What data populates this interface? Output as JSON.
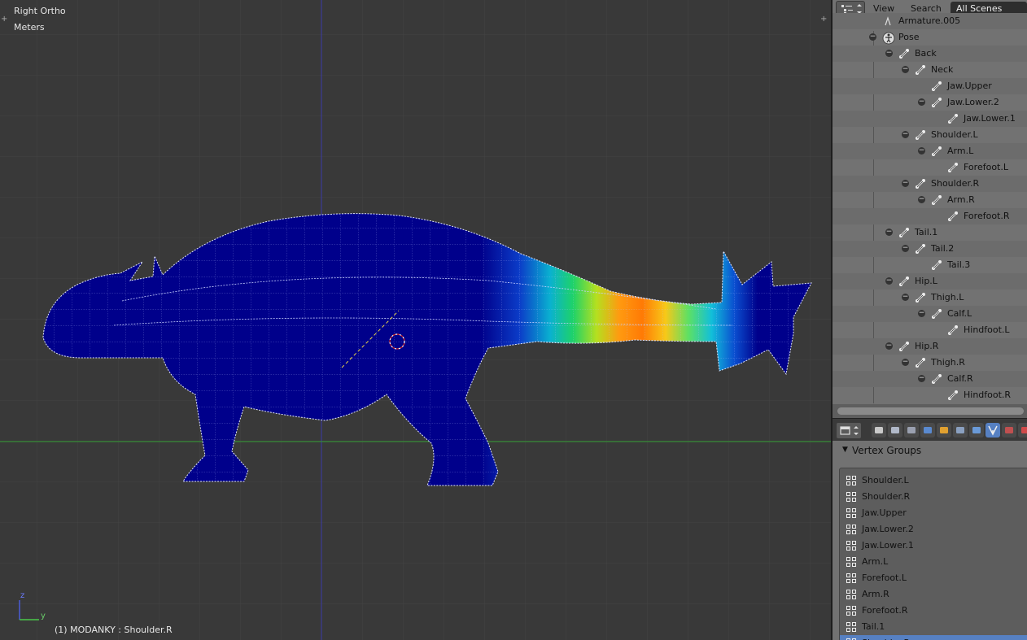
{
  "viewport": {
    "view_name": "Right Ortho",
    "units": "Meters",
    "status_text": "(1) MODANKY : Shoulder.R",
    "axis_z_label": "z",
    "axis_y_label": "y",
    "corner_plus": "+"
  },
  "outliner": {
    "menu": {
      "view": "View",
      "search": "Search",
      "scene": "All Scenes"
    },
    "rows": [
      {
        "label": "Armature.005",
        "indent": 0,
        "toggle": false,
        "icon": "armature-icon"
      },
      {
        "label": "Pose",
        "indent": 0,
        "toggle": true,
        "icon": "pose-icon"
      },
      {
        "label": "Back",
        "indent": 1,
        "toggle": true,
        "icon": "bone-icon"
      },
      {
        "label": "Neck",
        "indent": 2,
        "toggle": true,
        "icon": "bone-icon"
      },
      {
        "label": "Jaw.Upper",
        "indent": 3,
        "toggle": false,
        "icon": "bone-icon"
      },
      {
        "label": "Jaw.Lower.2",
        "indent": 3,
        "toggle": true,
        "icon": "bone-icon"
      },
      {
        "label": "Jaw.Lower.1",
        "indent": 4,
        "toggle": false,
        "icon": "bone-icon"
      },
      {
        "label": "Shoulder.L",
        "indent": 2,
        "toggle": true,
        "icon": "bone-icon"
      },
      {
        "label": "Arm.L",
        "indent": 3,
        "toggle": true,
        "icon": "bone-icon"
      },
      {
        "label": "Forefoot.L",
        "indent": 4,
        "toggle": false,
        "icon": "bone-icon"
      },
      {
        "label": "Shoulder.R",
        "indent": 2,
        "toggle": true,
        "icon": "bone-icon"
      },
      {
        "label": "Arm.R",
        "indent": 3,
        "toggle": true,
        "icon": "bone-icon"
      },
      {
        "label": "Forefoot.R",
        "indent": 4,
        "toggle": false,
        "icon": "bone-icon"
      },
      {
        "label": "Tail.1",
        "indent": 1,
        "toggle": true,
        "icon": "bone-icon"
      },
      {
        "label": "Tail.2",
        "indent": 2,
        "toggle": true,
        "icon": "bone-icon"
      },
      {
        "label": "Tail.3",
        "indent": 3,
        "toggle": false,
        "icon": "bone-icon"
      },
      {
        "label": "Hip.L",
        "indent": 1,
        "toggle": true,
        "icon": "bone-icon"
      },
      {
        "label": "Thigh.L",
        "indent": 2,
        "toggle": true,
        "icon": "bone-icon"
      },
      {
        "label": "Calf.L",
        "indent": 3,
        "toggle": true,
        "icon": "bone-icon"
      },
      {
        "label": "Hindfoot.L",
        "indent": 4,
        "toggle": false,
        "icon": "bone-icon"
      },
      {
        "label": "Hip.R",
        "indent": 1,
        "toggle": true,
        "icon": "bone-icon"
      },
      {
        "label": "Thigh.R",
        "indent": 2,
        "toggle": true,
        "icon": "bone-icon"
      },
      {
        "label": "Calf.R",
        "indent": 3,
        "toggle": true,
        "icon": "bone-icon"
      },
      {
        "label": "Hindfoot.R",
        "indent": 4,
        "toggle": false,
        "icon": "bone-icon"
      }
    ]
  },
  "properties": {
    "context_icons": [
      "render-icon",
      "render-layers-icon",
      "scene-icon",
      "world-icon",
      "object-icon",
      "constraints-icon",
      "modifiers-icon",
      "data-icon",
      "material-icon",
      "texture-icon"
    ],
    "active_context": "data-icon",
    "panel_title": "Vertex Groups",
    "vertex_groups": [
      "Shoulder.L",
      "Shoulder.R",
      "Jaw.Upper",
      "Jaw.Lower.2",
      "Jaw.Lower.1",
      "Arm.L",
      "Forefoot.L",
      "Arm.R",
      "Forefoot.R",
      "Tail.1",
      "Shoulder.R"
    ],
    "selected_index": 10
  },
  "colors": {
    "viewport_bg": "#393939",
    "mesh_blue": "#00008b",
    "x_axis_line": "#2f9b2f",
    "z_axis_line": "#3a3aa8",
    "selection_highlight": "#5680c2"
  }
}
